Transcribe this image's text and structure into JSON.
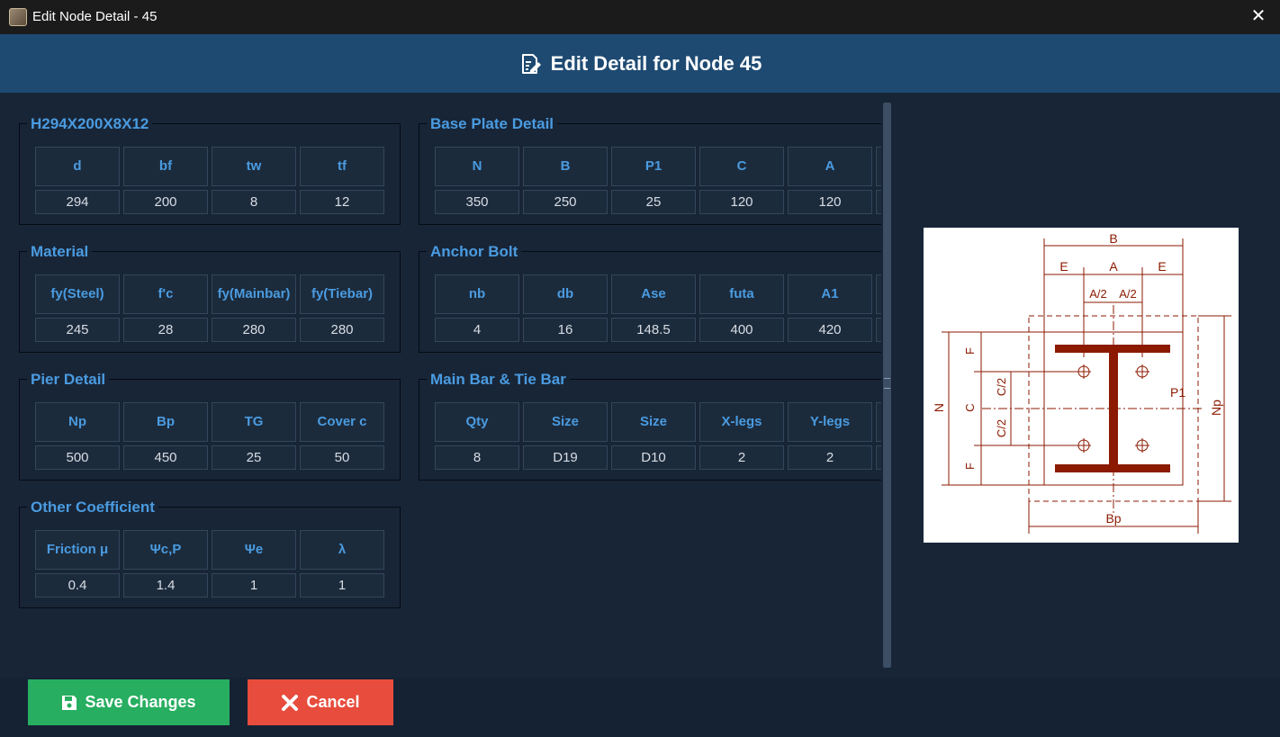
{
  "window": {
    "title": "Edit Node Detail - 45",
    "close_label": "✕"
  },
  "header": {
    "title": "Edit Detail for Node 45"
  },
  "groups": {
    "section": {
      "title": "H294X200X8X12",
      "headers": [
        "d",
        "bf",
        "tw",
        "tf"
      ],
      "values": [
        "294",
        "200",
        "8",
        "12"
      ]
    },
    "material": {
      "title": "Material",
      "headers": [
        "fy(Steel)",
        "f'c",
        "fy(Mainbar)",
        "fy(Tiebar)"
      ],
      "values": [
        "245",
        "28",
        "280",
        "280"
      ]
    },
    "pier": {
      "title": "Pier Detail",
      "headers": [
        "Np",
        "Bp",
        "TG",
        "Cover c"
      ],
      "values": [
        "500",
        "450",
        "25",
        "50"
      ]
    },
    "coeff": {
      "title": "Other Coefficient",
      "headers": [
        "Friction μ",
        "Ψc,P",
        "Ψe",
        "λ"
      ],
      "values": [
        "0.4",
        "1.4",
        "1",
        "1"
      ]
    },
    "baseplate": {
      "title": "Base Plate Detail",
      "headers": [
        "N",
        "B",
        "P1",
        "C",
        "A"
      ],
      "values": [
        "350",
        "250",
        "25",
        "120",
        "120"
      ]
    },
    "anchor": {
      "title": "Anchor Bolt",
      "headers": [
        "nb",
        "db",
        "Ase",
        "futa",
        "A1"
      ],
      "values": [
        "4",
        "16",
        "148.5",
        "400",
        "420"
      ]
    },
    "mainbar": {
      "title": "Main Bar & Tie Bar",
      "headers": [
        "Qty",
        "Size",
        "Size",
        "X-legs",
        "Y-legs"
      ],
      "values": [
        "8",
        "D19",
        "D10",
        "2",
        "2"
      ]
    }
  },
  "diagram_labels": {
    "B": "B",
    "E": "E",
    "A": "A",
    "A2": "A/2",
    "N": "N",
    "F": "F",
    "C": "C",
    "C2": "C/2",
    "P1": "P1",
    "Np": "Np",
    "Bp": "Bp"
  },
  "buttons": {
    "save": "Save Changes",
    "cancel": "Cancel"
  },
  "colors": {
    "accent": "#4a9be0",
    "header_bg": "#1e4a72",
    "save": "#27ae60",
    "cancel": "#e74c3c",
    "drawing": "#8b1a00"
  }
}
